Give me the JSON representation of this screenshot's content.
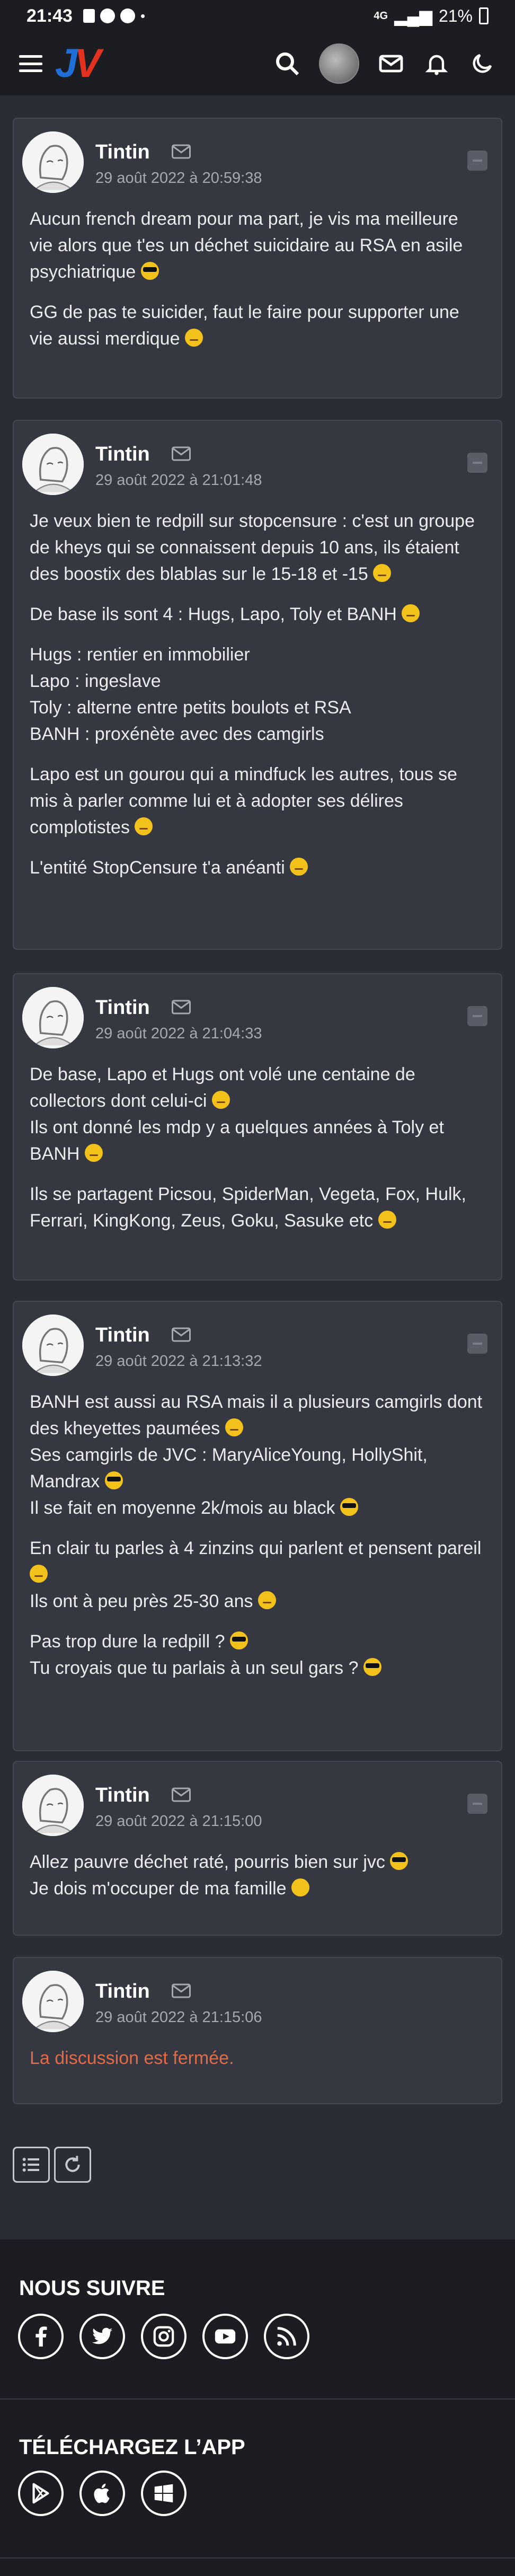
{
  "status_bar": {
    "time": "21:43",
    "network": "4G",
    "battery": "21%"
  },
  "app": {
    "logo_j": "J",
    "logo_v": "V"
  },
  "posts": [
    {
      "author": "Tintin",
      "date": "29 août 2022 à 20:59:38",
      "paragraphs": [
        "Aucun french dream pour ma part, je vis ma meilleure vie alors que t'es un déchet suicidaire au RSA en asile psychiatrique",
        "GG de pas te suicider, faut le faire pour supporter une vie aussi merdique"
      ]
    },
    {
      "author": "Tintin",
      "date": "29 août 2022 à 21:01:48",
      "paragraphs": [
        "Je veux bien te redpill sur stopcensure : c'est un groupe de kheys qui se connaissent depuis 10 ans, ils étaient des boostix des blablas sur le 15-18 et -15",
        "De base ils sont 4 : Hugs, Lapo, Toly et BANH",
        "Hugs : rentier en immobilier",
        "Lapo : ingeslave",
        "Toly : alterne entre petits boulots et RSA",
        "BANH : proxénète avec des camgirls",
        "Lapo est un gourou qui a mindfuck les autres, tous se mis à parler comme lui et à adopter ses délires complotistes",
        "L'entité StopCensure t'a anéanti"
      ]
    },
    {
      "author": "Tintin",
      "date": "29 août 2022 à 21:04:33",
      "paragraphs": [
        "De base, Lapo et Hugs ont volé une centaine de collectors dont celui-ci",
        "Ils ont donné les mdp y a quelques années à Toly et BANH",
        "Ils se partagent Picsou, SpiderMan, Vegeta, Fox, Hulk, Ferrari, KingKong, Zeus, Goku, Sasuke etc"
      ]
    },
    {
      "author": "Tintin",
      "date": "29 août 2022 à 21:13:32",
      "paragraphs": [
        "BANH est aussi au RSA mais il a plusieurs camgirls dont des kheyettes paumées",
        "Ses camgirls de JVC : MaryAliceYoung, HollyShit, Mandrax",
        "Il se fait en moyenne 2k/mois au black",
        "En clair tu parles à 4 zinzins qui parlent et pensent pareil",
        "Ils ont à peu près 25-30 ans",
        "Pas trop dure la redpill ?",
        "Tu croyais que tu parlais à un seul gars ?"
      ]
    },
    {
      "author": "Tintin",
      "date": "29 août 2022 à 21:15:00",
      "paragraphs": [
        "Allez pauvre déchet raté, pourris bien sur jvc",
        "Je dois m'occuper de ma famille"
      ]
    },
    {
      "author": "Tintin",
      "date": "29 août 2022 à 21:15:06",
      "paragraphs": [
        "La discussion est fermée."
      ]
    }
  ],
  "footer": {
    "follow_title": "NOUS SUIVRE",
    "social_icons": [
      "facebook-icon",
      "twitter-icon",
      "instagram-icon",
      "youtube-icon",
      "rss-icon"
    ],
    "app_title": "TÉLÉCHARGEZ L’APP",
    "app_icons": [
      "google-play-icon",
      "apple-icon",
      "windows-icon"
    ]
  },
  "colors": {
    "closed_text": "#e36a47",
    "logo_j": "#1f6fd6",
    "logo_v": "#e2321f"
  }
}
